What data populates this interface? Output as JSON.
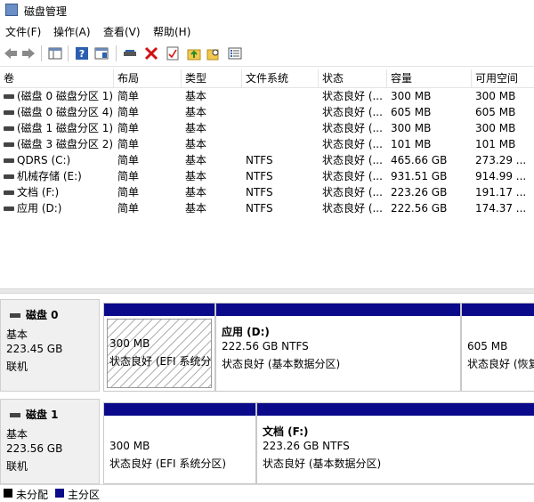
{
  "window": {
    "title": "磁盘管理"
  },
  "menu": [
    "文件(F)",
    "操作(A)",
    "查看(V)",
    "帮助(H)"
  ],
  "toolbar": {
    "icons": [
      "back-arrow-icon",
      "forward-arrow-icon",
      "console-tree-icon",
      "help-icon",
      "help-topics-icon",
      "connect-disk-icon",
      "delete-icon",
      "properties-icon",
      "up-folder-icon",
      "search-folder-icon",
      "list-view-icon"
    ]
  },
  "volumes": {
    "columns": [
      "卷",
      "布局",
      "类型",
      "文件系统",
      "状态",
      "容量",
      "可用空间"
    ],
    "rows": [
      [
        "(磁盘 0 磁盘分区 1)",
        "简单",
        "基本",
        "",
        "状态良好 (...",
        "300 MB",
        "300 MB"
      ],
      [
        "(磁盘 0 磁盘分区 4)",
        "简单",
        "基本",
        "",
        "状态良好 (...",
        "605 MB",
        "605 MB"
      ],
      [
        "(磁盘 1 磁盘分区 1)",
        "简单",
        "基本",
        "",
        "状态良好 (...",
        "300 MB",
        "300 MB"
      ],
      [
        "(磁盘 3 磁盘分区 2)",
        "简单",
        "基本",
        "",
        "状态良好 (...",
        "101 MB",
        "101 MB"
      ],
      [
        "QDRS (C:)",
        "简单",
        "基本",
        "NTFS",
        "状态良好 (...",
        "465.66 GB",
        "273.29 ..."
      ],
      [
        "机械存储 (E:)",
        "简单",
        "基本",
        "NTFS",
        "状态良好 (...",
        "931.51 GB",
        "914.99 ..."
      ],
      [
        "文档 (F:)",
        "简单",
        "基本",
        "NTFS",
        "状态良好 (...",
        "223.26 GB",
        "191.17 ..."
      ],
      [
        "应用 (D:)",
        "简单",
        "基本",
        "NTFS",
        "状态良好 (...",
        "222.56 GB",
        "174.37 ..."
      ]
    ]
  },
  "disks": [
    {
      "name": "磁盘 0",
      "type": "基本",
      "size": "223.45 GB",
      "status": "联机",
      "partitions": [
        {
          "title": "",
          "size": "300 MB",
          "status": "状态良好 (EFI 系统分"
        },
        {
          "title": "应用  (D:)",
          "size": "222.56 GB NTFS",
          "status": "状态良好 (基本数据分区)"
        },
        {
          "title": "",
          "size": "605 MB",
          "status": "状态良好 (恢复"
        }
      ]
    },
    {
      "name": "磁盘 1",
      "type": "基本",
      "size": "223.56 GB",
      "status": "联机",
      "partitions": [
        {
          "title": "",
          "size": "300 MB",
          "status": "状态良好 (EFI 系统分区)"
        },
        {
          "title": "文档  (F:)",
          "size": "223.26 GB NTFS",
          "status": "状态良好 (基本数据分区)"
        }
      ]
    }
  ],
  "legend": [
    {
      "label": "未分配",
      "color": "#000000"
    },
    {
      "label": "主分区",
      "color": "#0a0a8a"
    }
  ]
}
